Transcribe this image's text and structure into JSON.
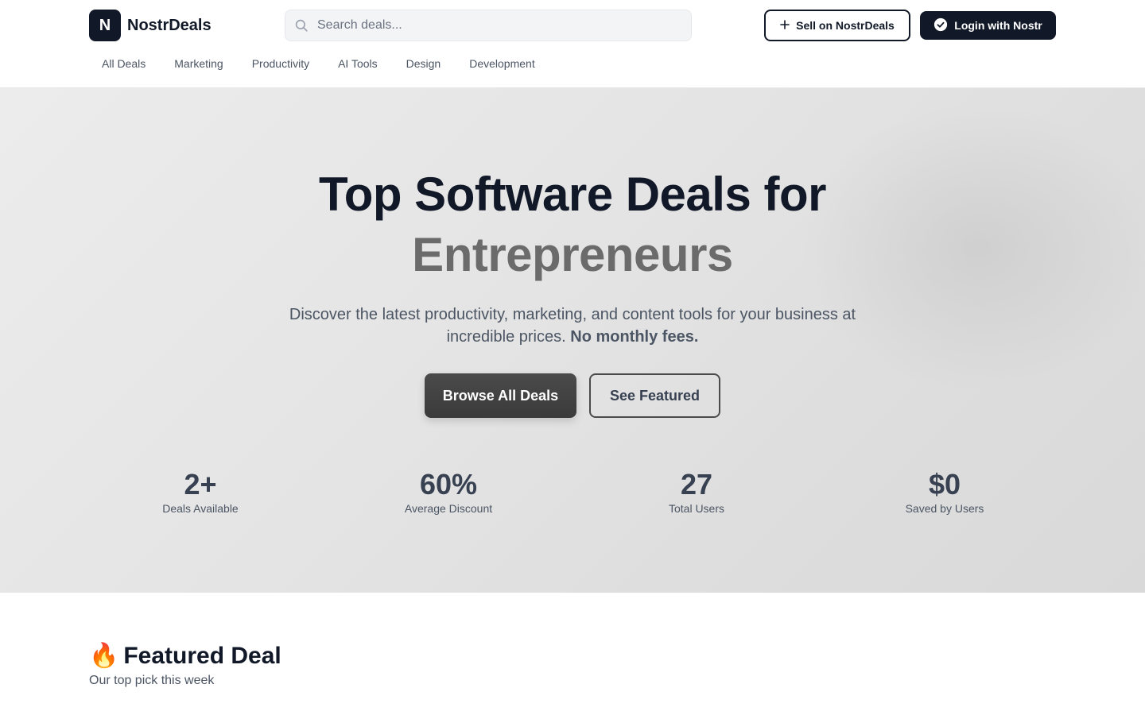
{
  "header": {
    "logo_letter": "N",
    "logo_text": "NostrDeals",
    "search_placeholder": "Search deals...",
    "sell_label": "Sell on NostrDeals",
    "login_label": "Login with Nostr"
  },
  "nav": {
    "items": [
      "All Deals",
      "Marketing",
      "Productivity",
      "AI Tools",
      "Design",
      "Development"
    ]
  },
  "hero": {
    "title_line1": "Top Software Deals for",
    "title_line2": "Entrepreneurs",
    "subtitle": "Discover the latest productivity, marketing, and content tools for your business at incredible prices.",
    "subtitle_bold": "No monthly fees.",
    "browse_label": "Browse All Deals",
    "featured_label": "See Featured"
  },
  "stats": [
    {
      "value": "2+",
      "label": "Deals Available"
    },
    {
      "value": "60%",
      "label": "Average Discount"
    },
    {
      "value": "27",
      "label": "Total Users"
    },
    {
      "value": "$0",
      "label": "Saved by Users"
    }
  ],
  "featured": {
    "icon": "🔥",
    "title": "Featured Deal",
    "subtitle": "Our top pick this week"
  }
}
